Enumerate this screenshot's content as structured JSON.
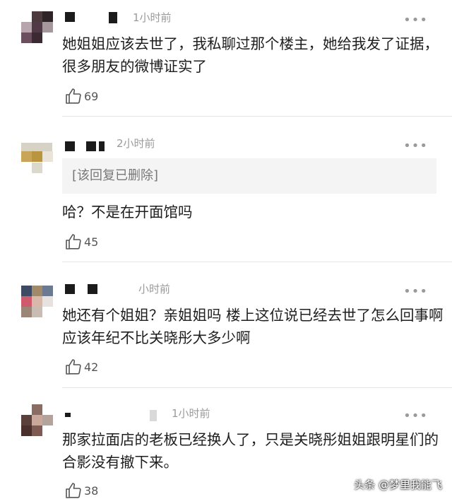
{
  "comments": [
    {
      "time": "1小时前",
      "text": "她姐姐应该去世了，我私聊过那个楼主，她给我发了证据，很多朋友的微博证实了",
      "likes": "69",
      "more": "•••"
    },
    {
      "time": "2小时前",
      "deleted_reply": "[该回复已删除]",
      "text": "哈？不是在开面馆吗",
      "likes": "45",
      "more": "•••"
    },
    {
      "time": "小时前",
      "text": "她还有个姐姐？亲姐姐吗 楼上这位说已经去世了怎么回事啊 应该年纪不比关晓彤大多少啊",
      "likes": "42",
      "more": "•••"
    },
    {
      "time": "1小时前",
      "text": "那家拉面店的老板已经换人了，只是关晓彤姐姐跟明星们的合影没有撤下来。",
      "likes": "38",
      "more": "•••"
    }
  ],
  "watermark": "头条 @梦里我能飞",
  "icons": {
    "like": "thumbs-up-icon",
    "more": "more-dots-icon"
  },
  "colors": {
    "text": "#1e1e1e",
    "meta": "#9a9a9a",
    "deleted_bg": "#f4f4f4"
  }
}
